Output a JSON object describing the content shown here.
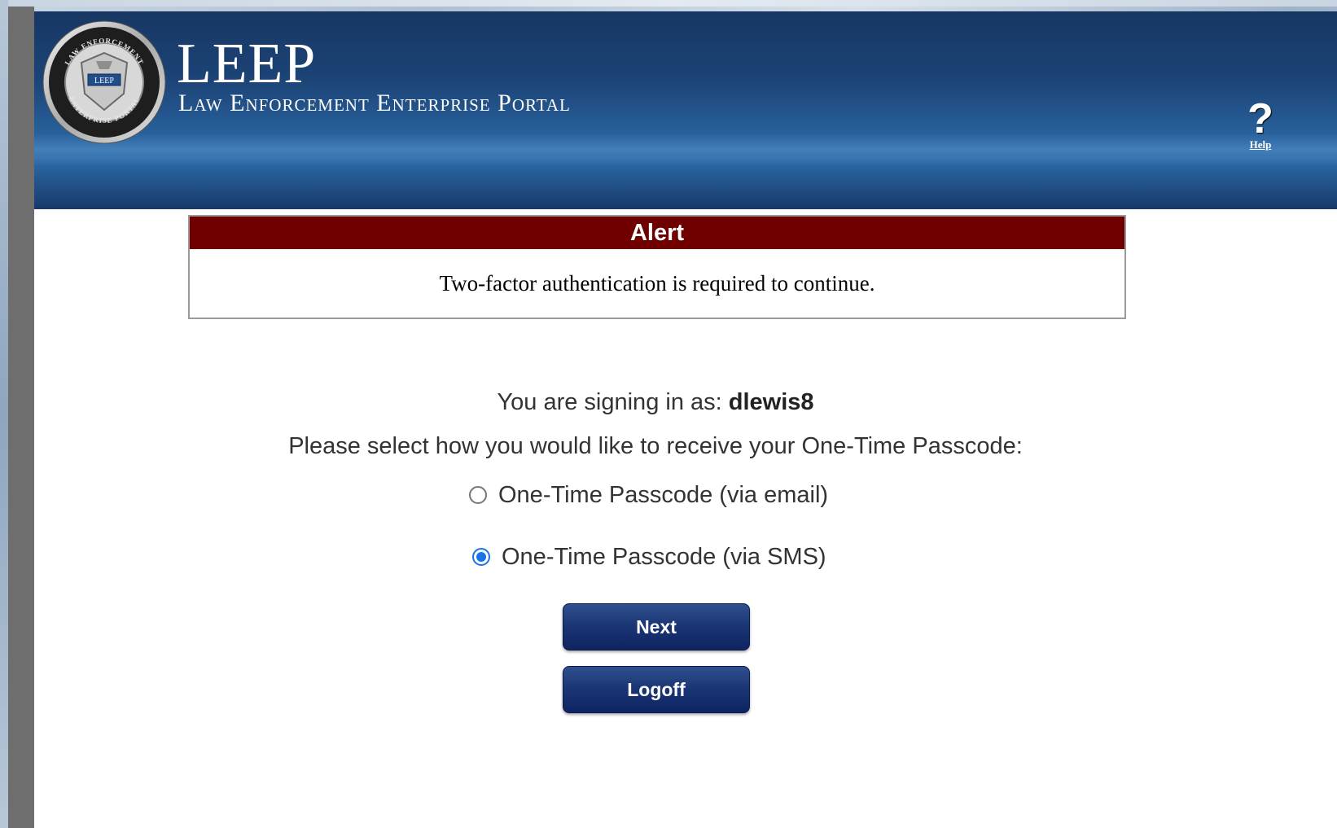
{
  "header": {
    "title": "LEEP",
    "subtitle": "Law Enforcement Enterprise Portal",
    "help_label": "Help",
    "help_glyph": "?"
  },
  "seal": {
    "ring_text_top": "LAW ENFORCEMENT",
    "ring_text_bottom": "ENTERPRISE PORTAL",
    "badge_text": "LEEP"
  },
  "alert": {
    "title": "Alert",
    "message": "Two-factor authentication is required to continue."
  },
  "signin": {
    "prefix": "You are signing in as: ",
    "username": "dlewis8",
    "prompt": "Please select how you would like to receive your One-Time Passcode:"
  },
  "options": [
    {
      "label": "One-Time Passcode (via email)",
      "selected": false
    },
    {
      "label": "One-Time Passcode (via SMS)",
      "selected": true
    }
  ],
  "buttons": {
    "next": "Next",
    "logoff": "Logoff"
  },
  "colors": {
    "alert_header": "#700000",
    "header_blue": "#1c4477",
    "button_blue": "#1a3473",
    "radio_selected": "#1a73e8"
  }
}
